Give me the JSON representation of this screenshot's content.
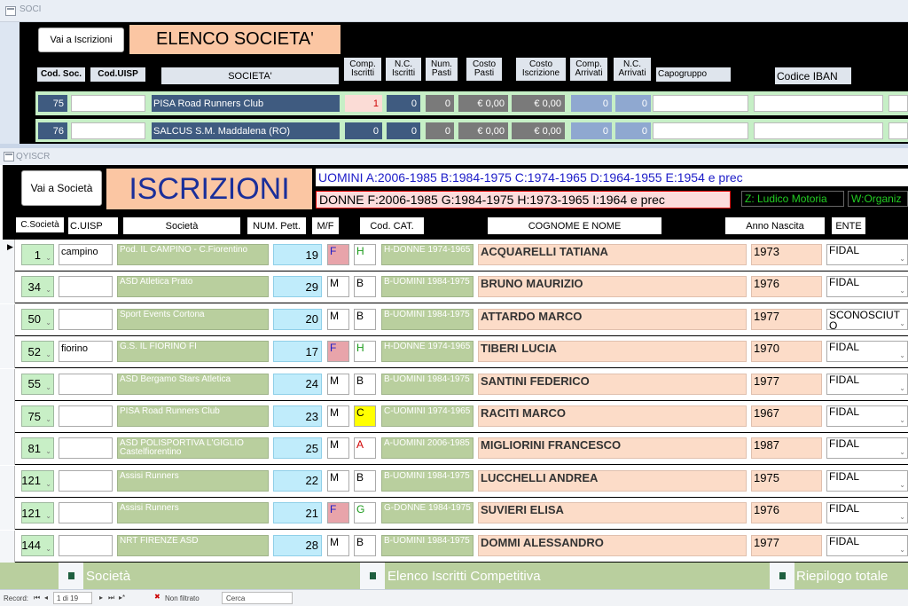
{
  "soci": {
    "window_title": "SOCI",
    "go_button": "Vai a Iscrizioni",
    "title": "ELENCO SOCIETA'",
    "headers": [
      "Cod. Soc.",
      "Cod.UISP",
      "SOCIETA'",
      "Comp. Iscritti",
      "N.C. Iscritti",
      "Num. Pasti",
      "Costo Pasti",
      "Costo Iscrizione",
      "Comp. Arrivati",
      "N.C. Arrivati",
      "Capogruppo",
      "Codice IBAN"
    ],
    "rows": [
      {
        "cod": "75",
        "uisp": "",
        "name": "PISA Road Runners Club",
        "comp": "1",
        "nc": "0",
        "pasti": "0",
        "costo_pasti": "€ 0,00",
        "costo_iscr": "€ 0,00",
        "comp_arr": "0",
        "nc_arr": "0"
      },
      {
        "cod": "76",
        "uisp": "",
        "name": "SALCUS S.M. Maddalena (RO)",
        "comp": "0",
        "nc": "0",
        "pasti": "0",
        "costo_pasti": "€ 0,00",
        "costo_iscr": "€ 0,00",
        "comp_arr": "0",
        "nc_arr": "0"
      }
    ]
  },
  "qyiscr": {
    "window_title": "QYISCR",
    "go_button": "Vai a Società",
    "title": "ISCRIZIONI",
    "legend_men": "UOMINI A:2006-1985   B:1984-1975   C:1974-1965   D:1964-1955   E:1954 e prec",
    "legend_women": "DONNE F:2006-1985   G:1984-1975   H:1973-1965   I:1964 e prec",
    "legend_z": "Z: Ludico Motoria",
    "legend_w": "W:Organiz",
    "headers": [
      "C.Società",
      "C.UISP",
      "Società",
      "NUM. Pett.",
      "M/F",
      "Cod. CAT.",
      "COGNOME E NOME",
      "Anno Nascita",
      "ENTE"
    ],
    "rows": [
      {
        "soc": "1",
        "uisp": "campino",
        "name": "Pod. IL CAMPINO - C.Fiorentino",
        "pett": "19",
        "mf": "F",
        "cat": "H",
        "catdesc": "H-DONNE 1974-1965",
        "person": "ACQUARELLI TATIANA",
        "year": "1973",
        "ente": "FIDAL"
      },
      {
        "soc": "34",
        "uisp": "",
        "name": "ASD Atletica Prato",
        "pett": "29",
        "mf": "M",
        "cat": "B",
        "catdesc": "B-UOMINI 1984-1975",
        "person": "BRUNO MAURIZIO",
        "year": "1976",
        "ente": "FIDAL"
      },
      {
        "soc": "50",
        "uisp": "",
        "name": "Sport Events Cortona",
        "pett": "20",
        "mf": "M",
        "cat": "B",
        "catdesc": "B-UOMINI 1984-1975",
        "person": "ATTARDO MARCO",
        "year": "1977",
        "ente": "SCONOSCIUTO"
      },
      {
        "soc": "52",
        "uisp": "fiorino",
        "name": "G.S. IL FIORINO FI",
        "pett": "17",
        "mf": "F",
        "cat": "H",
        "catdesc": "H-DONNE 1974-1965",
        "person": "TIBERI LUCIA",
        "year": "1970",
        "ente": "FIDAL"
      },
      {
        "soc": "55",
        "uisp": "",
        "name": "ASD Bergamo Stars Atletica",
        "pett": "24",
        "mf": "M",
        "cat": "B",
        "catdesc": "B-UOMINI 1984-1975",
        "person": "SANTINI FEDERICO",
        "year": "1977",
        "ente": "FIDAL"
      },
      {
        "soc": "75",
        "uisp": "",
        "name": "PISA Road Runners Club",
        "pett": "23",
        "mf": "M",
        "cat": "C",
        "catdesc": "C-UOMINI 1974-1965",
        "person": "RACITI MARCO",
        "year": "1967",
        "ente": "FIDAL"
      },
      {
        "soc": "81",
        "uisp": "",
        "name": "ASD POLISPORTIVA L'GIGLIO Castelfiorentino",
        "pett": "25",
        "mf": "M",
        "cat": "A",
        "catdesc": "A-UOMINI 2006-1985",
        "person": "MIGLIORINI FRANCESCO",
        "year": "1987",
        "ente": "FIDAL"
      },
      {
        "soc": "121",
        "uisp": "",
        "name": "Assisi Runners",
        "pett": "22",
        "mf": "M",
        "cat": "B",
        "catdesc": "B-UOMINI 1984-1975",
        "person": "LUCCHELLI ANDREA",
        "year": "1975",
        "ente": "FIDAL"
      },
      {
        "soc": "121",
        "uisp": "",
        "name": "Assisi Runners",
        "pett": "21",
        "mf": "F",
        "cat": "G",
        "catdesc": "G-DONNE 1984-1975",
        "person": "SUVIERI ELISA",
        "year": "1976",
        "ente": "FIDAL"
      },
      {
        "soc": "144",
        "uisp": "",
        "name": "NRT FIRENZE ASD",
        "pett": "28",
        "mf": "M",
        "cat": "B",
        "catdesc": "B-UOMINI 1984-1975",
        "person": "DOMMI ALESSANDRO",
        "year": "1977",
        "ente": "FIDAL"
      }
    ],
    "nav": [
      "Società",
      "Elenco Iscritti Competitiva",
      "Riepilogo totale"
    ],
    "record_label": "Record:",
    "record_pos": "1 di 19",
    "filter": "Non filtrato",
    "search": "Cerca"
  },
  "colors": {
    "peach": "#fbc6a3",
    "green": "#b9cf9e",
    "cyan": "#c0ecfb",
    "navy": "#3f5b80"
  }
}
